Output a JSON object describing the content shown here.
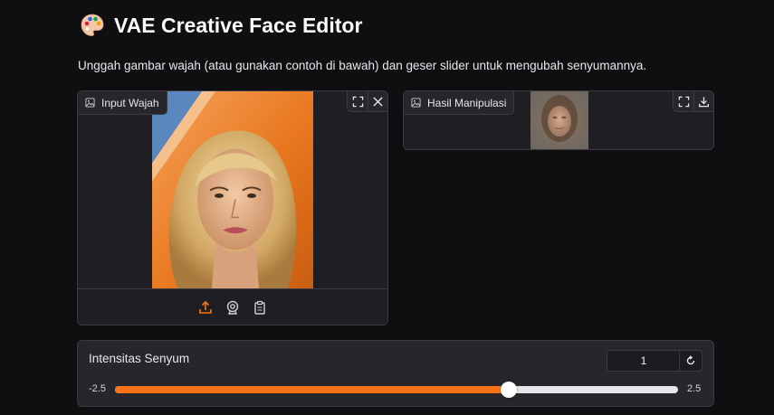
{
  "page": {
    "title": "VAE Creative Face Editor",
    "title_icon": "palette-icon",
    "description": "Unggah gambar wajah (atau gunakan contoh di bawah) dan geser slider untuk mengubah senyumannya."
  },
  "input_panel": {
    "label": "Input Wajah",
    "label_icon": "image-icon",
    "tools": [
      "fullscreen-icon",
      "close-icon"
    ],
    "sources": [
      "upload-icon",
      "webcam-icon",
      "clipboard-icon"
    ],
    "active_source": "upload-icon"
  },
  "output_panel": {
    "label": "Hasil Manipulasi",
    "label_icon": "image-icon",
    "tools": [
      "fullscreen-icon",
      "download-icon"
    ]
  },
  "slider": {
    "label": "Intensitas Senyum",
    "value": "1",
    "min": "-2.5",
    "max": "2.5",
    "fraction": 0.7,
    "reset_icon": "reset-icon"
  },
  "colors": {
    "background": "#0f0f11",
    "panel": "#1f1f23",
    "accent": "#f97316",
    "border": "#3a3a40"
  }
}
